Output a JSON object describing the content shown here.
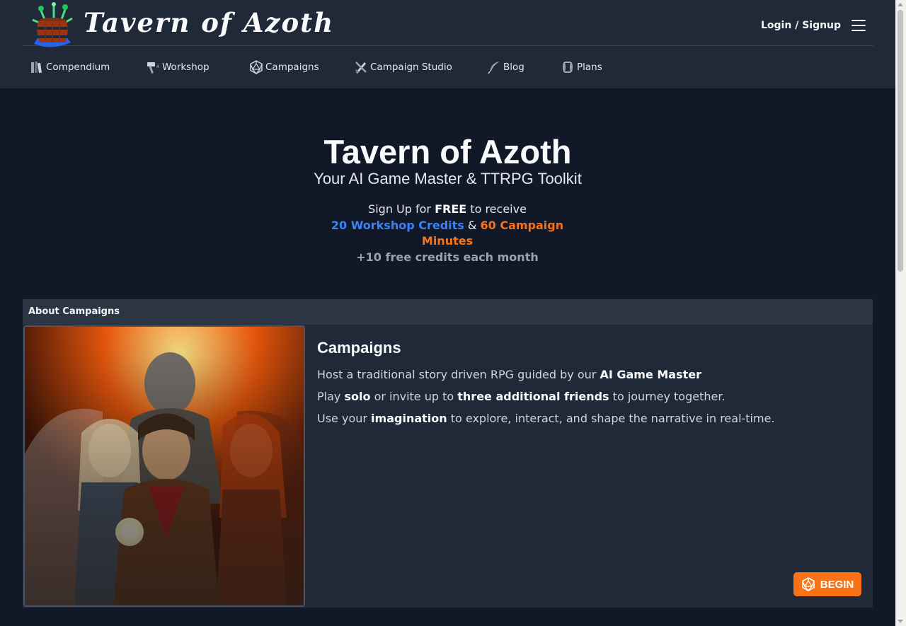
{
  "header": {
    "site_name": "Tavern of Azoth",
    "login_label": "Login / Signup",
    "menu_icon": "hamburger-menu-icon"
  },
  "nav": {
    "items": [
      {
        "label": "Compendium",
        "icon": "books-icon"
      },
      {
        "label": "Workshop",
        "icon": "hammer-icon"
      },
      {
        "label": "Campaigns",
        "icon": "d20-icon"
      },
      {
        "label": "Campaign Studio",
        "icon": "pen-sword-icon"
      },
      {
        "label": "Blog",
        "icon": "quill-icon"
      },
      {
        "label": "Plans",
        "icon": "scroll-icon"
      }
    ]
  },
  "hero": {
    "title": "Tavern of Azoth",
    "subtitle": "Your AI Game Master & TTRPG Toolkit",
    "promo_prefix": "Sign Up for",
    "promo_free": "FREE",
    "promo_suffix": "to receive",
    "workshop_credits": "20 Workshop Credits",
    "ampersand": "&",
    "campaign_minutes": "60 Campaign Minutes",
    "monthly": "+10 free credits each month"
  },
  "about": {
    "header": "About Campaigns",
    "title": "Campaigns",
    "p1_text": "Host a traditional story driven RPG guided by our",
    "p1_bold": "AI Game Master",
    "p2_a": "Play",
    "p2_b": "solo",
    "p2_c": "or invite up to",
    "p2_d": "three additional friends",
    "p2_e": "to journey together.",
    "p3_a": "Use your",
    "p3_b": "imagination",
    "p3_c": "to explore, interact, and shape the narrative in real-time."
  },
  "begin_button": {
    "label": "BEGIN",
    "icon": "d20-icon"
  },
  "colors": {
    "background": "#111827",
    "header": "#1f2937",
    "accent_blue": "#3b82f6",
    "accent_orange": "#f97316"
  }
}
